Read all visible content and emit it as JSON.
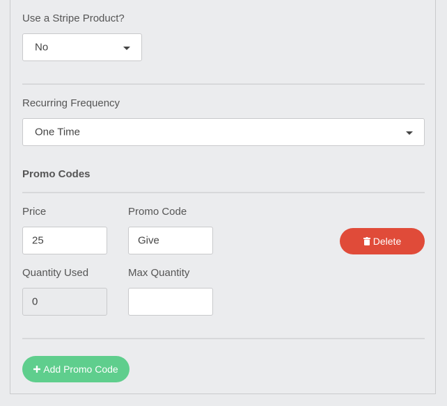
{
  "stripe_product": {
    "label": "Use a Stripe Product?",
    "selected": "No"
  },
  "recurring": {
    "label": "Recurring Frequency",
    "selected": "One Time"
  },
  "promo": {
    "section_title": "Promo Codes",
    "price_label": "Price",
    "price_value": "25",
    "code_label": "Promo Code",
    "code_value": "Give",
    "delete_label": "Delete",
    "qty_used_label": "Quantity Used",
    "qty_used_value": "0",
    "max_qty_label": "Max Quantity",
    "max_qty_value": "",
    "add_label": "Add Promo Code"
  },
  "colors": {
    "delete": "#e04b39",
    "add": "#5fce8d"
  },
  "icons": {
    "select_caret": "caret-down-icon",
    "delete": "trash-icon",
    "add": "plus-icon"
  }
}
